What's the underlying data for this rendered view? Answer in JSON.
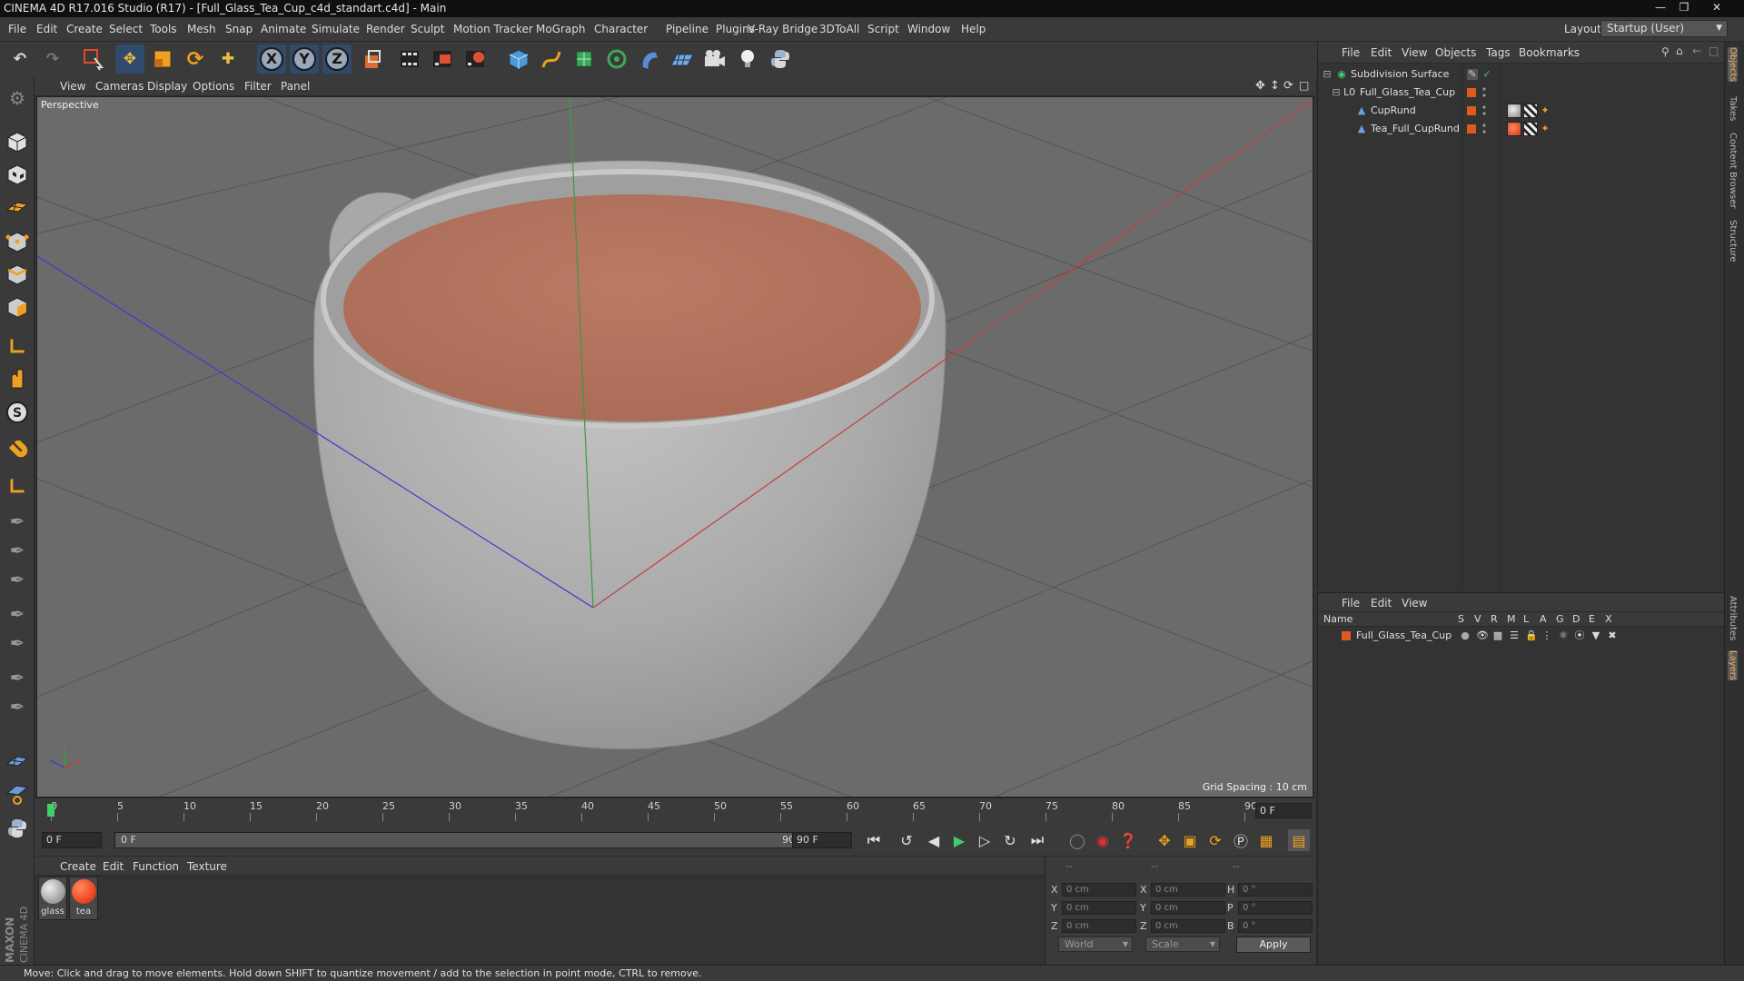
{
  "window": {
    "title": "CINEMA 4D R17.016 Studio (R17) - [Full_Glass_Tea_Cup_c4d_standart.c4d] - Main",
    "controls": [
      "minimize",
      "restore",
      "close"
    ]
  },
  "menubar": {
    "items": [
      "File",
      "Edit",
      "Create",
      "Select",
      "Tools",
      "Mesh",
      "Snap",
      "Animate",
      "Simulate",
      "Render",
      "Sculpt",
      "Motion Tracker",
      "MoGraph",
      "Character",
      "Pipeline",
      "Plugins",
      "V-Ray Bridge",
      "3DToAll",
      "Script",
      "Window",
      "Help"
    ],
    "layout_label": "Layout:",
    "layout_value": "Startup (User)"
  },
  "toolbar": {
    "icons": [
      "undo-icon",
      "redo-icon",
      "live-selection-icon",
      "move-icon",
      "scale-icon",
      "rotate-icon",
      "last-tool-icon",
      "x-axis-icon",
      "y-axis-icon",
      "z-axis-icon",
      "coordinate-system-icon",
      "render-view-icon",
      "render-picture-viewer-icon",
      "edit-render-settings-icon",
      "cube-icon",
      "pen-spline-icon",
      "subdivision-icon",
      "array-icon",
      "deformer-icon",
      "floor-icon",
      "camera-icon",
      "light-icon",
      "python-icon"
    ],
    "axis_x": "X",
    "axis_y": "Y",
    "axis_z": "Z"
  },
  "viewport": {
    "menu": [
      "View",
      "Cameras",
      "Display",
      "Options",
      "Filter",
      "Panel"
    ],
    "label": "Perspective",
    "grid_spacing": "Grid Spacing : 10 cm",
    "colors": {
      "background": "#6b6b6b",
      "cup": "#b4b4b4",
      "tea": "#b87560",
      "x_axis": "#c83a3a",
      "y_axis": "#3aa03a",
      "z_axis": "#3a3ac8"
    }
  },
  "timeline": {
    "ticks": [
      "0",
      "5",
      "10",
      "15",
      "20",
      "25",
      "30",
      "35",
      "40",
      "45",
      "50",
      "55",
      "60",
      "65",
      "70",
      "75",
      "80",
      "85",
      "90"
    ],
    "current_frame": "0 F"
  },
  "transport": {
    "start_field": "0 F",
    "range_start": "0 F",
    "range_end": "90 F",
    "end_field": "90 F"
  },
  "materials": {
    "menu": [
      "Create",
      "Edit",
      "Function",
      "Texture"
    ],
    "items": [
      {
        "name": "glass",
        "color": "#c8c8c8"
      },
      {
        "name": "tea",
        "color": "#ee4a22"
      }
    ]
  },
  "coordinates": {
    "headers": [
      "--",
      "--",
      "--"
    ],
    "rows": [
      {
        "a": "X",
        "av": "0 cm",
        "b": "X",
        "bv": "0 cm",
        "c": "H",
        "cv": "0 °"
      },
      {
        "a": "Y",
        "av": "0 cm",
        "b": "Y",
        "bv": "0 cm",
        "c": "P",
        "cv": "0 °"
      },
      {
        "a": "Z",
        "av": "0 cm",
        "b": "Z",
        "bv": "0 cm",
        "c": "B",
        "cv": "0 °"
      }
    ],
    "space": "World",
    "mode": "Scale",
    "apply": "Apply"
  },
  "object_manager": {
    "menu": [
      "File",
      "Edit",
      "View",
      "Objects",
      "Tags",
      "Bookmarks"
    ],
    "objects": [
      {
        "name": "Subdivision Surface",
        "icon": "subdivision-icon"
      },
      {
        "name": "Full_Glass_Tea_Cup",
        "icon": "null-object-icon"
      },
      {
        "name": "CupRund",
        "icon": "polygon-object-icon"
      },
      {
        "name": "Tea_Full_CupRund",
        "icon": "polygon-object-icon"
      }
    ]
  },
  "layer_manager": {
    "menu": [
      "File",
      "Edit",
      "View"
    ],
    "columns": [
      "Name",
      "S",
      "V",
      "R",
      "M",
      "L",
      "A",
      "G",
      "D",
      "E",
      "X"
    ],
    "layers": [
      {
        "name": "Full_Glass_Tea_Cup",
        "color": "#e05a1e"
      }
    ]
  },
  "right_tabs": [
    "Objects",
    "Takes",
    "Content Browser",
    "Structure",
    "Attributes",
    "Layers"
  ],
  "statusbar": {
    "text": "Move: Click and drag to move elements. Hold down SHIFT to quantize movement / add to the selection in point mode, CTRL to remove."
  },
  "branding": {
    "vendor": "MAXON",
    "product": "CINEMA 4D"
  }
}
